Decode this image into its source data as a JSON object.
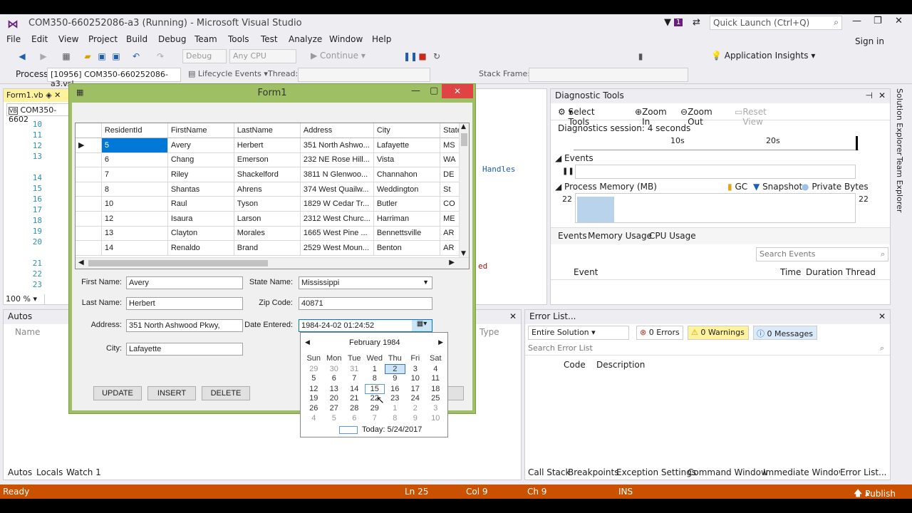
{
  "window": {
    "title": "COM350-660252086-a3 (Running) - Microsoft Visual Studio",
    "quick_launch": "Quick Launch (Ctrl+Q)",
    "notifications": "1",
    "sign_in": "Sign in"
  },
  "menu": [
    "File",
    "Edit",
    "View",
    "Project",
    "Build",
    "Debug",
    "Team",
    "Tools",
    "Test",
    "Analyze",
    "Window",
    "Help"
  ],
  "toolbar": {
    "config": "Debug",
    "platform": "Any CPU",
    "continue": "Continue",
    "app_insights": "Application Insights"
  },
  "debugbar": {
    "process_label": "Process:",
    "process": "[10956] COM350-660252086-a3.vsl",
    "lifecycle": "Lifecycle Events",
    "thread_label": "Thread:",
    "stack_label": "Stack Frame:"
  },
  "editor": {
    "tab": "Form1.vb",
    "file_dropdown": "COM350-6602",
    "zoom": "100 %",
    "lines": [
      "10",
      "11",
      "12",
      "13",
      "14",
      "15",
      "16",
      "17",
      "18",
      "19",
      "20",
      "21",
      "22",
      "23"
    ],
    "code_frag1": "Handles",
    "code_frag2": "ed"
  },
  "form": {
    "title": "Form1",
    "columns": [
      "ResidentId",
      "FirstName",
      "LastName",
      "Address",
      "City",
      "State"
    ],
    "rows": [
      [
        "5",
        "Avery",
        "Herbert",
        "351 North Ashwo...",
        "Lafayette",
        "MS"
      ],
      [
        "6",
        "Chang",
        "Emerson",
        "232 NE Rose Hill...",
        "Vista",
        "WA"
      ],
      [
        "7",
        "Riley",
        "Shackelford",
        "3811 N Glenwoo...",
        "Channahon",
        "DE"
      ],
      [
        "8",
        "Shantas",
        "Ahrens",
        "374 West Quailw...",
        "Weddington",
        "St"
      ],
      [
        "10",
        "Raul",
        "Tyson",
        "1829 W Cedar Tr...",
        "Butler",
        "CO"
      ],
      [
        "12",
        "Isaura",
        "Larson",
        "2312 West Churc...",
        "Harriman",
        "ME"
      ],
      [
        "13",
        "Clayton",
        "Morales",
        "1665 West Pine ...",
        "Bennettsville",
        "AR"
      ],
      [
        "14",
        "Renaldo",
        "Brand",
        "2529 West Moun...",
        "Benton",
        "AR"
      ]
    ],
    "labels": {
      "first": "First Name:",
      "last": "Last Name:",
      "address": "Address:",
      "city": "City:",
      "state": "State Name:",
      "zip": "Zip Code:",
      "date": "Date Entered:"
    },
    "values": {
      "first": "Avery",
      "last": "Herbert",
      "address": "351 North Ashwood Pkwy,",
      "city": "Lafayette",
      "state": "Mississippi",
      "zip": "40871",
      "date": "1984-24-02 01:24:52"
    },
    "buttons": {
      "update": "UPDATE",
      "insert": "INSERT",
      "delete": "DELETE"
    }
  },
  "calendar": {
    "month": "February 1984",
    "days": [
      "Sun",
      "Mon",
      "Tue",
      "Wed",
      "Thu",
      "Fri",
      "Sat"
    ],
    "weeks": [
      [
        "29",
        "30",
        "31",
        "1",
        "2",
        "3",
        "4"
      ],
      [
        "5",
        "6",
        "7",
        "8",
        "9",
        "10",
        "11"
      ],
      [
        "12",
        "13",
        "14",
        "15",
        "16",
        "17",
        "18"
      ],
      [
        "19",
        "20",
        "21",
        "22",
        "23",
        "24",
        "25"
      ],
      [
        "26",
        "27",
        "28",
        "29",
        "1",
        "2",
        "3"
      ],
      [
        "4",
        "5",
        "6",
        "7",
        "8",
        "9",
        "10"
      ]
    ],
    "today": "Today: 5/24/2017"
  },
  "diagnostics": {
    "title": "Diagnostic Tools",
    "select_tools": "Select Tools",
    "zoom_in": "Zoom In",
    "zoom_out": "Zoom Out",
    "reset_view": "Reset View",
    "session": "Diagnostics session: 4 seconds",
    "t10": "10s",
    "t20": "20s",
    "events": "Events",
    "process_memory": "Process Memory (MB)",
    "gc": "GC",
    "snapshot": "Snapshot",
    "private_bytes": "Private Bytes",
    "mem_left": "22",
    "mem_right": "22",
    "tabs": [
      "Events",
      "Memory Usage",
      "CPU Usage"
    ],
    "search": "Search Events",
    "cols": [
      "Event",
      "Time",
      "Duration",
      "Thread"
    ]
  },
  "side_tabs": [
    "Solution Explorer",
    "Team Explorer"
  ],
  "autos": {
    "title": "Autos",
    "col_name": "Name",
    "col_type": "Type",
    "tabs": [
      "Autos",
      "Locals",
      "Watch 1"
    ]
  },
  "errors": {
    "title": "Error List...",
    "scope": "Entire Solution",
    "errors": "0 Errors",
    "warnings": "0 Warnings",
    "messages": "0 Messages",
    "search": "Search Error List",
    "cols": [
      "Code",
      "Description"
    ],
    "tabs": [
      "Call Stack",
      "Breakpoints",
      "Exception Settings",
      "Command Window",
      "Immediate Window",
      "Error List..."
    ]
  },
  "status": {
    "ready": "Ready",
    "ln": "Ln 25",
    "col": "Col 9",
    "ch": "Ch 9",
    "ins": "INS",
    "publish": "Publish"
  }
}
